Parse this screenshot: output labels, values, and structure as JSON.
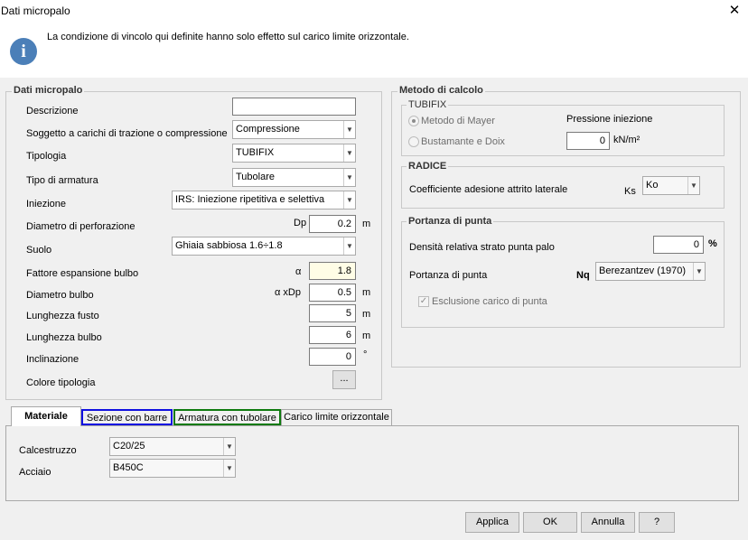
{
  "window": {
    "title": "Dati micropalo",
    "close_glyph": "✕"
  },
  "info": {
    "icon": "info-icon",
    "text": "La condizione di vincolo qui definite hanno solo effetto sul carico limite orizzontale."
  },
  "left_group": {
    "legend": "Dati micropalo",
    "descrizione": {
      "label": "Descrizione",
      "value": ""
    },
    "soggetto": {
      "label": "Soggetto a carichi di trazione o compressione",
      "value": "Compressione"
    },
    "tipologia": {
      "label": "Tipologia",
      "value": "TUBIFIX"
    },
    "tipo_armatura": {
      "label": "Tipo di armatura",
      "value": "Tubolare"
    },
    "iniezione": {
      "label": "Iniezione",
      "value": "IRS: Iniezione ripetitiva e selettiva"
    },
    "diametro_perf": {
      "label": "Diametro di perforazione",
      "symbol": "Dp",
      "value": "0.2",
      "unit": "m"
    },
    "suolo": {
      "label": "Suolo",
      "value": "Ghiaia sabbiosa 1.6÷1.8"
    },
    "fattore": {
      "label": "Fattore espansione bulbo",
      "symbol": "α",
      "value": "1.8"
    },
    "diametro_bulbo": {
      "label": "Diametro bulbo",
      "symbol": "α xDp",
      "value": "0.5",
      "unit": "m"
    },
    "lunghezza_fusto": {
      "label": "Lunghezza fusto",
      "value": "5",
      "unit": "m"
    },
    "lunghezza_bulbo": {
      "label": "Lunghezza bulbo",
      "value": "6",
      "unit": "m"
    },
    "inclinazione": {
      "label": "Inclinazione",
      "value": "0",
      "unit": "°"
    },
    "colore": {
      "label": "Colore tipologia",
      "button": "..."
    }
  },
  "right_group": {
    "legend": "Metodo di calcolo",
    "tubifix": {
      "legend": "TUBIFIX",
      "mayer": "Metodo di Mayer",
      "bustamante": "Bustamante e Doix",
      "pressione_label": "Pressione iniezione",
      "pressione_value": "0",
      "pressione_unit": "kN/m²"
    },
    "radice": {
      "legend": "RADICE",
      "label": "Coefficiente adesione attrito laterale",
      "symbol": "Ks",
      "value": "Ko"
    },
    "portanza": {
      "legend": "Portanza di punta",
      "densita_label": "Densità relativa strato punta palo",
      "densita_value": "0",
      "densita_unit": "%",
      "portanza_label": "Portanza di punta",
      "symbol": "Nq",
      "value": "Berezantzev (1970)",
      "esclusione": "Esclusione carico di punta"
    }
  },
  "tabs": [
    "Materiale",
    "Sezione con barre",
    "Armatura con tubolare",
    "Carico limite orizzontale"
  ],
  "materiale": {
    "calcestruzzo": {
      "label": "Calcestruzzo",
      "value": "C20/25"
    },
    "acciaio": {
      "label": "Acciaio",
      "value": "B450C"
    }
  },
  "buttons": {
    "applica": "Applica",
    "ok": "OK",
    "annulla": "Annulla",
    "help": "?"
  }
}
